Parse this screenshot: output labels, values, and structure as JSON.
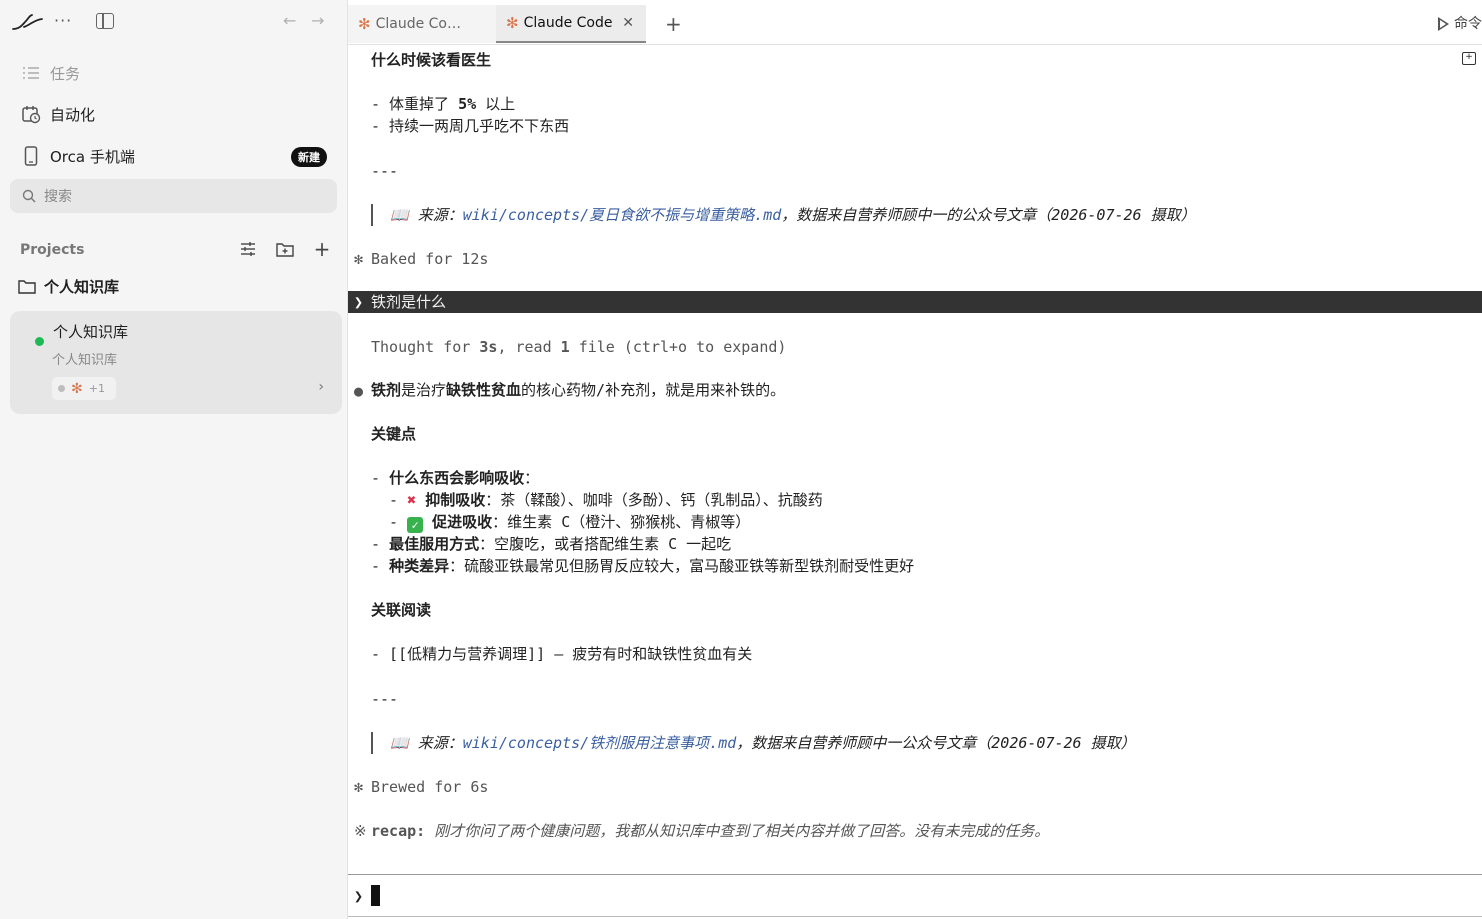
{
  "sidebar": {
    "nav": [
      {
        "label": "任务",
        "icon": "list-icon"
      },
      {
        "label": "自动化",
        "icon": "calendar-clock-icon"
      },
      {
        "label": "Orca 手机端",
        "icon": "phone-icon",
        "badge": "新建"
      }
    ],
    "search_placeholder": "搜索",
    "projects_label": "Projects",
    "folder_label": "个人知识库",
    "project": {
      "title": "个人知识库",
      "subtitle": "个人知识库",
      "chip_count": "+1"
    }
  },
  "tabs": [
    {
      "label": "Claude Co…",
      "active": false
    },
    {
      "label": "Claude Code",
      "active": true
    }
  ],
  "toolbar": {
    "command_label": "命令"
  },
  "terminal": {
    "heading_doctor": "什么时候该看医生",
    "doctor_items": [
      "- 体重掉了 ",
      "5%",
      " 以上",
      "- 持续一两周几乎吃不下东西"
    ],
    "hr": "---",
    "source1_prefix": "来源：",
    "source1_link": "wiki/concepts/夏日食欲不振与增重策略.md",
    "source1_rest": "，数据来自营养师顾中一的公众号文章（2026-07-26 摄取）",
    "baked": "Baked for 12s",
    "prompt_question": "铁剂是什么",
    "thought_prefix": "Thought for ",
    "thought_secs": "3s",
    "thought_mid": ", read ",
    "thought_count": "1",
    "thought_suffix": " file (ctrl+o to expand)",
    "answer_b1": "铁剂",
    "answer_t1": "是治疗",
    "answer_b2": "缺铁性贫血",
    "answer_t2": "的核心药物/补充剂，就是用来补铁的。",
    "key_points": "关键点",
    "kp1_label": "什么东西会影响吸收",
    "kp1_colon": "：",
    "kp1a_label": "抑制吸收",
    "kp1a_text": "：茶（鞣酸）、咖啡（多酚）、钙（乳制品）、抗酸药",
    "kp1b_label": "促进吸收",
    "kp1b_text": "：维生素 C（橙汁、猕猴桃、青椒等）",
    "kp2_label": "最佳服用方式",
    "kp2_text": "：空腹吃，或者搭配维生素 C 一起吃",
    "kp3_label": "种类差异",
    "kp3_text": "：硫酸亚铁最常见但肠胃反应较大，富马酸亚铁等新型铁剂耐受性更好",
    "related": "关联阅读",
    "related_item": "- [[低精力与营养调理]] — 疲劳有时和缺铁性贫血有关",
    "source2_prefix": "来源：",
    "source2_link": "wiki/concepts/铁剂服用注意事项.md",
    "source2_rest": "，数据来自营养师顾中一公众号文章（2026-07-26 摄取）",
    "brewed": "Brewed for 6s",
    "recap_label": "recap:",
    "recap_text": " 刚才你问了两个健康问题，我都从知识库中查到了相关内容并做了回答。没有未完成的任务。"
  },
  "colors": {
    "accent_star": "#d9774f",
    "status_green": "#1db954",
    "link": "#3a5fa0"
  }
}
